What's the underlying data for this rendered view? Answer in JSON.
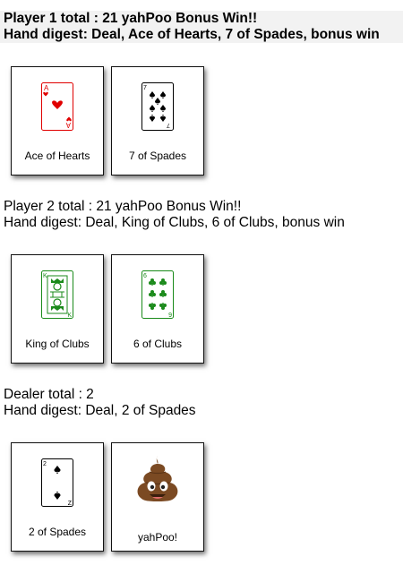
{
  "players": [
    {
      "total_line": "Player 1 total : 21 yahPoo Bonus Win!!",
      "digest_line": "Hand digest: Deal, Ace of Hearts, 7 of Spades, bonus win",
      "bold": true,
      "cards": [
        {
          "label": "Ace of Hearts",
          "rank": "A",
          "suit": "hearts",
          "color": "#e00000"
        },
        {
          "label": "7 of Spades",
          "rank": "7",
          "suit": "spades",
          "color": "#000000"
        }
      ]
    },
    {
      "total_line": "Player 2 total : 21 yahPoo Bonus Win!!",
      "digest_line": "Hand digest: Deal, King of Clubs, 6 of Clubs, bonus win",
      "bold": false,
      "cards": [
        {
          "label": "King of Clubs",
          "rank": "K",
          "suit": "clubs",
          "color": "#1a8a1a"
        },
        {
          "label": "6 of Clubs",
          "rank": "6",
          "suit": "clubs",
          "color": "#1a8a1a"
        }
      ]
    },
    {
      "total_line": "Dealer total : 2",
      "digest_line": "Hand digest: Deal, 2 of Spades",
      "bold": false,
      "cards": [
        {
          "label": "2 of Spades",
          "rank": "2",
          "suit": "spades",
          "color": "#000000"
        },
        {
          "label": "yahPoo!",
          "icon": "poo-emoji-icon"
        }
      ]
    }
  ]
}
